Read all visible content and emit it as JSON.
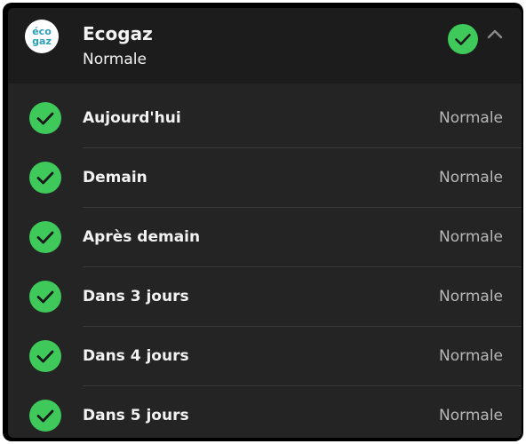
{
  "header": {
    "logo_text_top": "éco",
    "logo_text_bottom": "gaz",
    "title": "Ecogaz",
    "subtitle": "Normale",
    "status_icon": "check-circle-icon",
    "collapse_icon": "chevron-up-icon"
  },
  "colors": {
    "status_ok": "#3ec95a",
    "card_bg": "#242424",
    "header_bg": "#1c1c1c",
    "logo_text": "#2a9fb6"
  },
  "rows": [
    {
      "label": "Aujourd'hui",
      "value": "Normale",
      "icon": "check-circle-icon"
    },
    {
      "label": "Demain",
      "value": "Normale",
      "icon": "check-circle-icon"
    },
    {
      "label": "Après demain",
      "value": "Normale",
      "icon": "check-circle-icon"
    },
    {
      "label": "Dans 3 jours",
      "value": "Normale",
      "icon": "check-circle-icon"
    },
    {
      "label": "Dans 4 jours",
      "value": "Normale",
      "icon": "check-circle-icon"
    },
    {
      "label": "Dans 5 jours",
      "value": "Normale",
      "icon": "check-circle-icon"
    }
  ]
}
